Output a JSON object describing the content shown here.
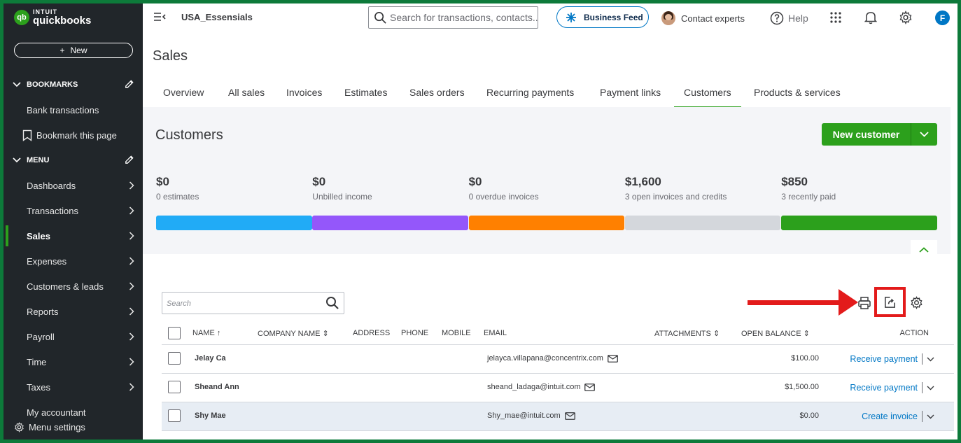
{
  "brand": {
    "top": "INTUIT",
    "bottom": "quickbooks",
    "mark": "qb"
  },
  "sidebar": {
    "new_label": "New",
    "bookmarks_header": "BOOKMARKS",
    "bookmarks": [
      "Bank transactions",
      "Bookmark this page"
    ],
    "menu_header": "MENU",
    "items": [
      "Dashboards",
      "Transactions",
      "Sales",
      "Expenses",
      "Customers & leads",
      "Reports",
      "Payroll",
      "Time",
      "Taxes",
      "My accountant"
    ],
    "active": "Sales",
    "menu_settings": "Menu settings"
  },
  "topbar": {
    "company": "USA_Essensials",
    "search_placeholder": "Search for transactions, contacts...",
    "business_feed": "Business Feed",
    "contact_experts": "Contact experts",
    "help": "Help",
    "user_initial": "F"
  },
  "page": {
    "title": "Sales"
  },
  "tabs": [
    "Overview",
    "All sales",
    "Invoices",
    "Estimates",
    "Sales orders",
    "Recurring payments",
    "Payment links",
    "Customers",
    "Products & services"
  ],
  "active_tab": "Customers",
  "customers": {
    "title": "Customers",
    "new_button": "New customer",
    "stats": [
      {
        "amount": "$0",
        "label": "0 estimates",
        "color": "#21abf6"
      },
      {
        "amount": "$0",
        "label": "Unbilled income",
        "color": "#9457fa"
      },
      {
        "amount": "$0",
        "label": "0 overdue invoices",
        "color": "#ff8000"
      },
      {
        "amount": "$1,600",
        "label": "3 open invoices and credits",
        "color": "#d4d7dc"
      },
      {
        "amount": "$850",
        "label": "3 recently paid",
        "color": "#2ca01c"
      }
    ]
  },
  "table": {
    "search_placeholder": "Search",
    "headers": {
      "name": "NAME",
      "company": "COMPANY NAME",
      "address": "ADDRESS",
      "phone": "PHONE",
      "mobile": "MOBILE",
      "email": "EMAIL",
      "attachments": "ATTACHMENTS",
      "open_balance": "OPEN BALANCE",
      "action": "ACTION"
    },
    "rows": [
      {
        "name": "Jelay Ca",
        "email": "jelayca.villapana@concentrix.com",
        "balance": "$100.00",
        "action": "Receive payment"
      },
      {
        "name": "Sheand Ann",
        "email": "sheand_ladaga@intuit.com",
        "balance": "$1,500.00",
        "action": "Receive payment"
      },
      {
        "name": "Shy Mae",
        "email": "Shy_mae@intuit.com",
        "balance": "$0.00",
        "action": "Create invoice"
      }
    ]
  },
  "colors": {
    "accent": "#2ca01c",
    "link": "#0077c5",
    "annotation": "#e31b1b",
    "sidebar": "#21262a"
  }
}
